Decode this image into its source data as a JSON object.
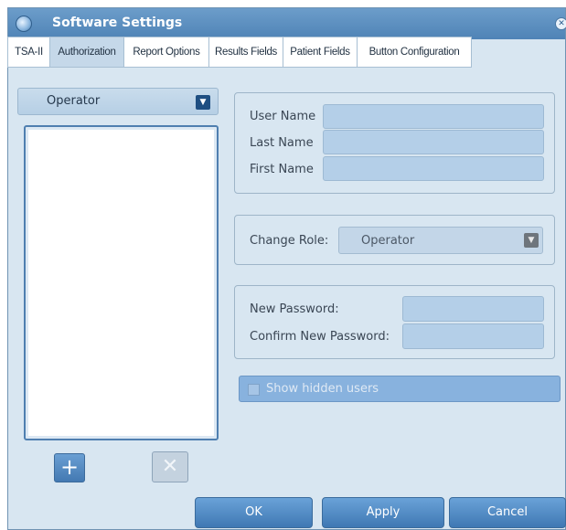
{
  "window": {
    "title": "Software Settings"
  },
  "tabs": [
    {
      "label": "TSA-II"
    },
    {
      "label": "Authorization",
      "active": true
    },
    {
      "label": "Report Options"
    },
    {
      "label": "Results Fields"
    },
    {
      "label": "Patient Fields"
    },
    {
      "label": "Button Configuration"
    }
  ],
  "left_panel": {
    "role_filter": "Operator",
    "users": [],
    "add_icon": "+",
    "delete_icon": "✕"
  },
  "user_info": {
    "user_name_label": "User Name",
    "user_name_value": "",
    "last_name_label": "Last Name",
    "last_name_value": "",
    "first_name_label": "First Name",
    "first_name_value": ""
  },
  "role": {
    "label": "Change Role:",
    "value": "Operator"
  },
  "password": {
    "new_label": "New Password:",
    "confirm_label": "Confirm New Password:"
  },
  "show_hidden_users": {
    "label": "Show hidden users",
    "checked": false
  },
  "footer": {
    "ok": "OK",
    "apply": "Apply",
    "cancel": "Cancel"
  },
  "colors": {
    "accent": "#4f83b6",
    "background": "#d8e6f1",
    "field": "#b4cfe8"
  },
  "icons": {
    "app": "app-globe-icon",
    "close": "close-icon",
    "dropdown": "chevron-down-icon"
  }
}
